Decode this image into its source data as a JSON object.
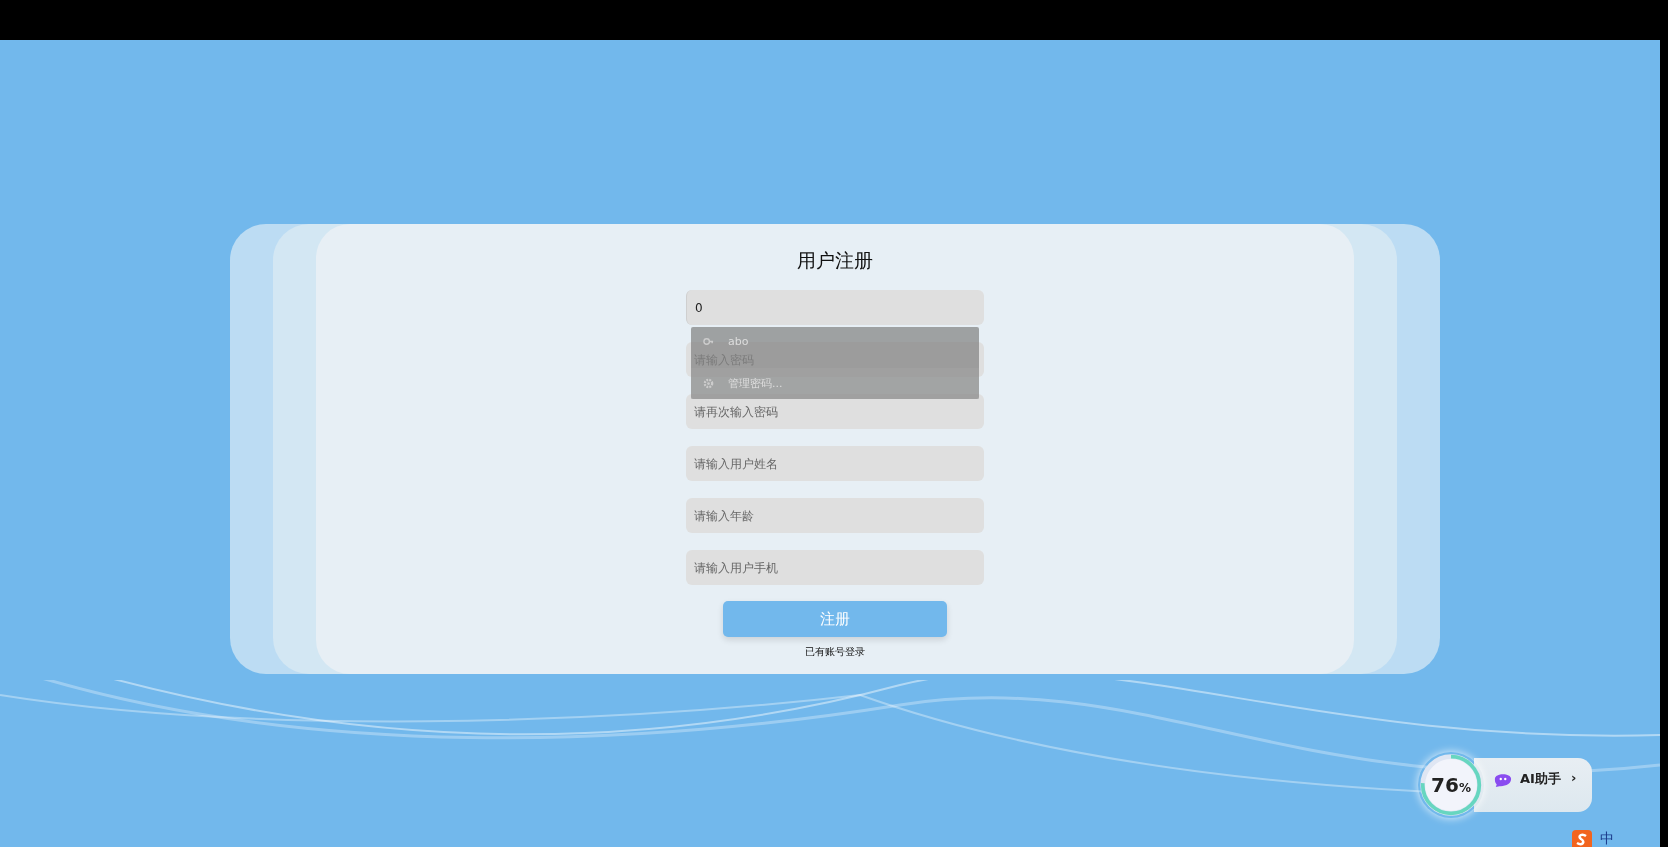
{
  "title": "用户注册",
  "fields": [
    {
      "value": "0",
      "focused": true
    },
    {
      "placeholder": "请输入密码",
      "focused": false
    },
    {
      "placeholder": "请再次输入密码",
      "focused": false
    },
    {
      "placeholder": "请输入用户姓名",
      "focused": false
    },
    {
      "placeholder": "请输入年龄",
      "focused": false
    },
    {
      "placeholder": "请输入用户手机",
      "focused": false
    }
  ],
  "autocomplete": {
    "items": [
      {
        "kind": "account",
        "label": "abo"
      },
      {
        "kind": "manage",
        "label": "管理密码..."
      }
    ]
  },
  "register_button": "注册",
  "login_link": "已有账号登录",
  "widget": {
    "percent": "76",
    "unit": "%",
    "level": 0.76,
    "assistant": "AI助手",
    "chevron": "›"
  },
  "tray": {
    "ime": "中"
  }
}
